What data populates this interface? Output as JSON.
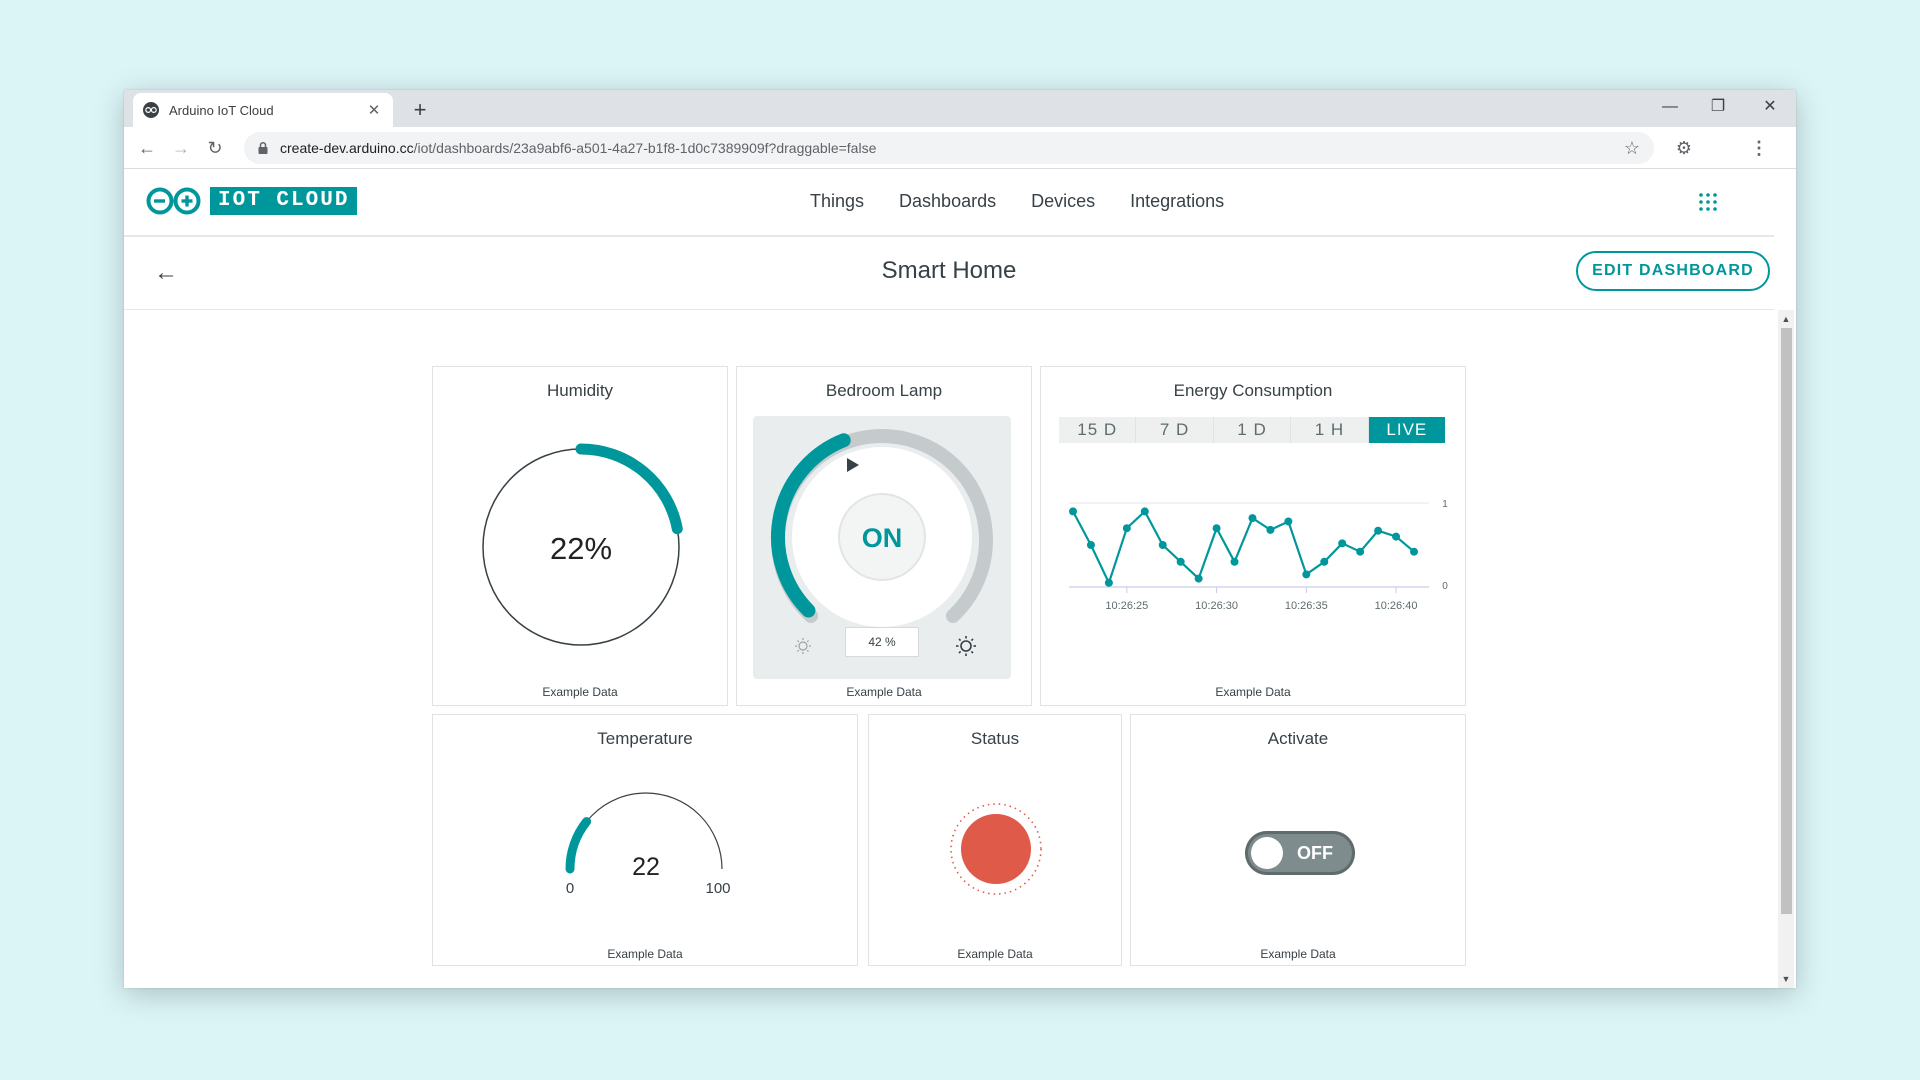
{
  "browser": {
    "tab_title": "Arduino IoT Cloud",
    "tab_close": "✕",
    "new_tab": "+",
    "url_host": "create-dev.arduino.cc",
    "url_path": "/iot/dashboards/23a9abf6-a501-4a27-b1f8-1d0c7389909f?draggable=false"
  },
  "header": {
    "logo_text": "IOT CLOUD",
    "nav": [
      "Things",
      "Dashboards",
      "Devices",
      "Integrations"
    ]
  },
  "dashboard": {
    "title": "Smart Home",
    "edit_button": "EDIT DASHBOARD"
  },
  "widgets": {
    "humidity": {
      "title": "Humidity",
      "value_text": "22%",
      "level": 0.22,
      "footer": "Example Data"
    },
    "lamp": {
      "title": "Bedroom Lamp",
      "state": "ON",
      "brightness_text": "42 %",
      "level": 0.42,
      "footer": "Example Data"
    },
    "energy": {
      "title": "Energy Consumption",
      "ranges": [
        "15 D",
        "7 D",
        "1 D",
        "1 H",
        "LIVE"
      ],
      "active_range": "LIVE",
      "footer": "Example Data"
    },
    "temperature": {
      "title": "Temperature",
      "value": "22",
      "min": "0",
      "max": "100",
      "footer": "Example Data"
    },
    "status": {
      "title": "Status",
      "footer": "Example Data",
      "color": "#e05a4a"
    },
    "activate": {
      "title": "Activate",
      "state": "OFF",
      "footer": "Example Data"
    }
  },
  "chart_data": {
    "type": "line",
    "x_ticks": [
      "10:26:25",
      "10:26:30",
      "10:26:35",
      "10:26:40"
    ],
    "y_ticks": [
      "1",
      "0"
    ],
    "ylim": [
      0,
      1
    ],
    "series": [
      {
        "values": [
          0.9,
          0.5,
          0.05,
          0.7,
          0.9,
          0.5,
          0.3,
          0.1,
          0.7,
          0.3,
          0.82,
          0.68,
          0.78,
          0.15,
          0.3,
          0.52,
          0.42,
          0.67,
          0.6,
          0.42
        ],
        "color": "#00979c"
      }
    ],
    "x_start": 10.26,
    "x_step": 1,
    "grid": true
  },
  "colors": {
    "accent": "#00979c",
    "status_red": "#e05a4a"
  }
}
